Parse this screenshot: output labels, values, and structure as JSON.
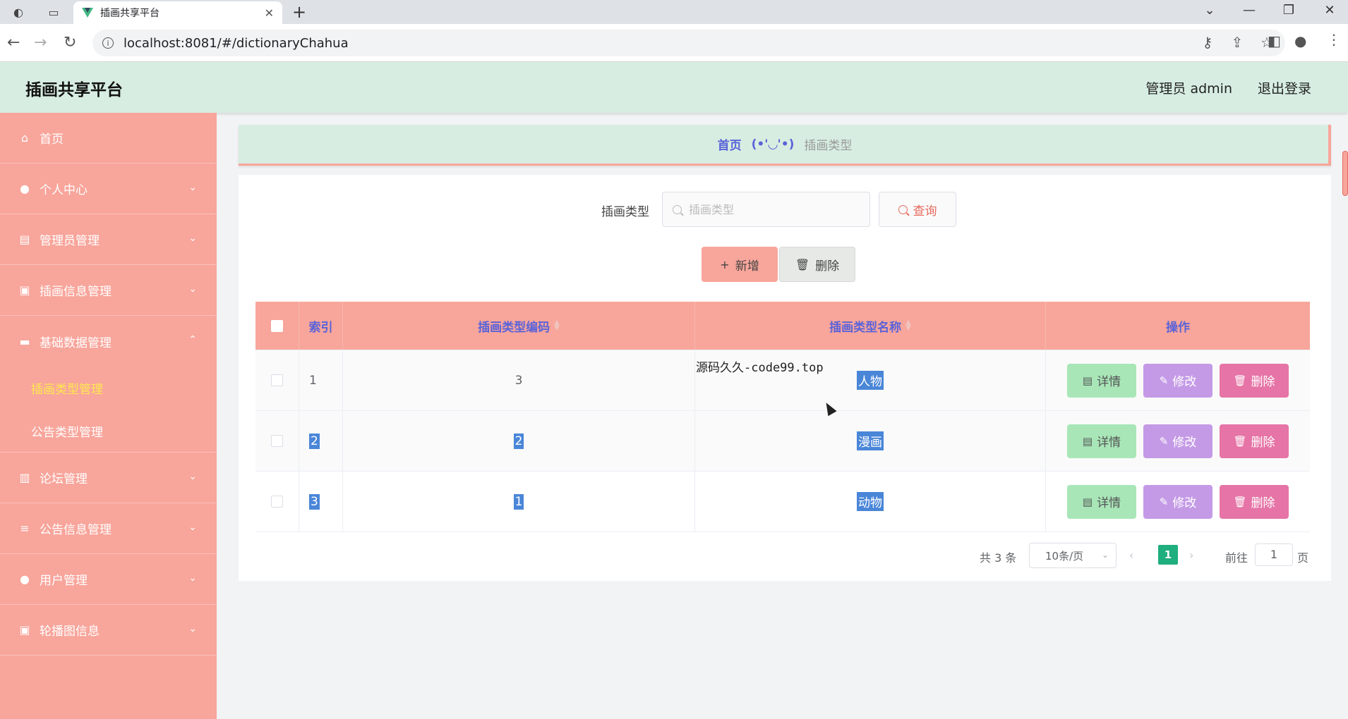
{
  "browser": {
    "tab_title": "插画共享平台",
    "close_symbol": "✕",
    "new_tab_symbol": "+",
    "url": "localhost:8081/#/dictionaryChahua"
  },
  "header": {
    "app_title": "插画共享平台",
    "admin_label": "管理员 admin",
    "logout_label": "退出登录"
  },
  "sidebar": {
    "items": [
      {
        "label": "首页",
        "icon": "home-icon"
      },
      {
        "label": "个人中心",
        "icon": "user-icon"
      },
      {
        "label": "管理员管理",
        "icon": "admin-icon"
      },
      {
        "label": "插画信息管理",
        "icon": "clipboard-icon"
      },
      {
        "label": "基础数据管理",
        "icon": "monitor-icon"
      },
      {
        "label": "论坛管理",
        "icon": "chart-icon"
      },
      {
        "label": "公告信息管理",
        "icon": "list-icon"
      },
      {
        "label": "用户管理",
        "icon": "user-icon"
      },
      {
        "label": "轮播图信息",
        "icon": "clipboard-icon"
      }
    ],
    "sub_items": [
      "插画类型管理",
      "公告类型管理"
    ]
  },
  "breadcrumb": {
    "home": "首页",
    "separator": "(•'◡'•)",
    "current": "插画类型"
  },
  "search": {
    "label": "插画类型",
    "placeholder": "插画类型",
    "query_label": "查询"
  },
  "actions": {
    "add_label": "新增",
    "delete_label": "删除"
  },
  "table": {
    "columns": [
      "索引",
      "插画类型编码",
      "插画类型名称",
      "操作"
    ],
    "rows": [
      {
        "index": "1",
        "code": "3",
        "name": "人物"
      },
      {
        "index": "2",
        "code": "2",
        "name": "漫画"
      },
      {
        "index": "3",
        "code": "1",
        "name": "动物"
      }
    ],
    "row_actions": {
      "detail": "详情",
      "edit": "修改",
      "delete": "删除"
    },
    "overlay_text": "源码久久-code99.top"
  },
  "pagination": {
    "total": "共 3 条",
    "page_size": "10条/页",
    "current_page": "1",
    "goto_label": "前往",
    "goto_value": "1",
    "page_unit": "页"
  },
  "colors": {
    "sidebar": "#f8a59b",
    "header": "#d7ede1",
    "accent": "#5a63d8",
    "active_page": "#1fae7d"
  }
}
